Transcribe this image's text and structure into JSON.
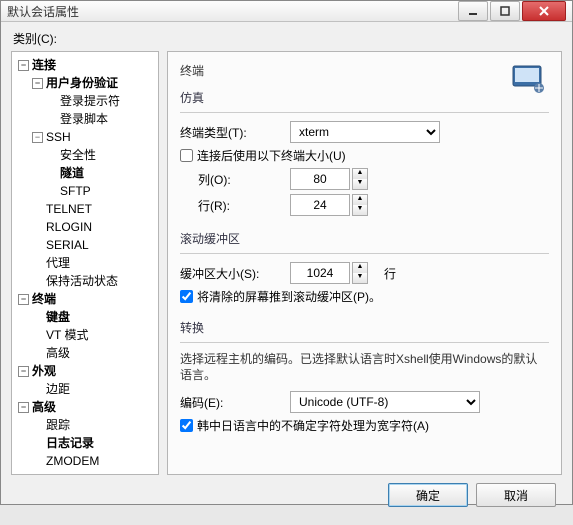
{
  "titlebar": {
    "title": "默认会话属性"
  },
  "category_label": "类别(C):",
  "tree": {
    "connection": "连接",
    "auth": "用户身份验证",
    "login_prompt": "登录提示符",
    "login_script": "登录脚本",
    "ssh": "SSH",
    "security": "安全性",
    "tunnel": "隧道",
    "sftp": "SFTP",
    "telnet": "TELNET",
    "rlogin": "RLOGIN",
    "serial": "SERIAL",
    "proxy": "代理",
    "keepalive": "保持活动状态",
    "terminal": "终端",
    "keyboard": "键盘",
    "vt": "VT 模式",
    "advanced_t": "高级",
    "appearance": "外观",
    "margins": "边距",
    "advanced": "高级",
    "trace": "跟踪",
    "logging": "日志记录",
    "zmodem": "ZMODEM"
  },
  "panel": {
    "title": "终端",
    "emulation": {
      "group": "仿真",
      "type_label": "终端类型(T):",
      "type_value": "xterm",
      "use_size_label": "连接后使用以下终端大小(U)",
      "use_size_checked": false,
      "cols_label": "列(O):",
      "cols_value": "80",
      "rows_label": "行(R):",
      "rows_value": "24"
    },
    "scroll": {
      "group": "滚动缓冲区",
      "size_label": "缓冲区大小(S):",
      "size_value": "1024",
      "unit": "行",
      "push_label": "将清除的屏幕推到滚动缓冲区(P)。",
      "push_checked": true
    },
    "conv": {
      "group": "转换",
      "desc": "选择远程主机的编码。已选择默认语言时Xshell使用Windows的默认语言。",
      "enc_label": "编码(E):",
      "enc_value": "Unicode (UTF-8)",
      "wide_label": "韩中日语言中的不确定字符处理为宽字符(A)",
      "wide_checked": true
    }
  },
  "footer": {
    "ok": "确定",
    "cancel": "取消"
  }
}
